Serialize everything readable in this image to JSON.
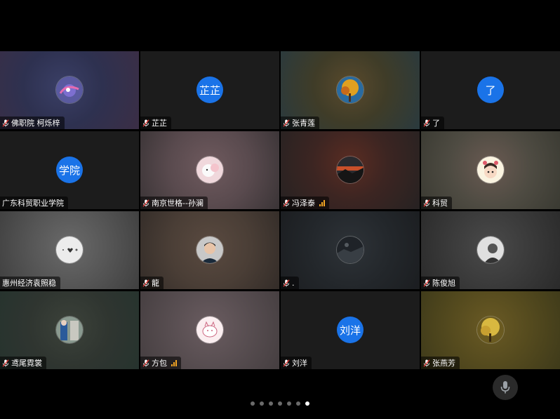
{
  "accent_color": "#1a73e8",
  "signal_color": "#f5a623",
  "icons": {
    "muted_mic": "mic-off-icon",
    "signal": "signal-bars-icon",
    "self_mic": "microphone-icon"
  },
  "participants": [
    {
      "name": "佛职院 柯烁梓",
      "muted": true,
      "avatar_kind": "image",
      "avatar_theme": "purple-wave",
      "tile_bg": "radial-gradient(circle at 45% 45%, #3a3f66 0%, #2e3150 45%, #3b2e45 100%)"
    },
    {
      "name": "芷芷",
      "muted": true,
      "avatar_kind": "text",
      "avatar_text": "芷芷",
      "tile_bg": "#1c1c1c"
    },
    {
      "name": "张青莲",
      "muted": true,
      "avatar_kind": "image",
      "avatar_theme": "autumn-tree",
      "tile_bg": "radial-gradient(circle at 50% 45%, #5a4a2c 0%, #3f3c28 45%, #2a3a3e 100%)"
    },
    {
      "name": "了",
      "muted": true,
      "avatar_kind": "text",
      "avatar_text": "了",
      "tile_bg": "#1c1c1c"
    },
    {
      "name": "广东科贸职业学院",
      "muted": false,
      "avatar_kind": "text",
      "avatar_text": "学院",
      "tile_bg": "#1c1c1c"
    },
    {
      "name": "南京世格--孙澜",
      "muted": true,
      "avatar_kind": "image",
      "avatar_theme": "pink-plush",
      "tile_bg": "radial-gradient(circle at 50% 45%, #6f5a5e 0%, #594a4e 50%, #3a3436 100%)"
    },
    {
      "name": "冯泽泰",
      "muted": true,
      "signal": true,
      "avatar_kind": "image",
      "avatar_theme": "sunset",
      "tile_bg": "radial-gradient(circle at 50% 40%, #5a2c22 0%, #3c2522 45%, #262222 100%)"
    },
    {
      "name": "科贸",
      "muted": true,
      "avatar_kind": "image",
      "avatar_theme": "bunny-girl",
      "tile_bg": "radial-gradient(circle at 50% 45%, #6a5a52 0%, #4e4b42 50%, #3a3a32 100%)"
    },
    {
      "name": "惠州经济袁照稳",
      "muted": false,
      "avatar_kind": "image",
      "avatar_theme": "white-heart",
      "tile_bg": "radial-gradient(circle at 50% 45%, #6a6a6a 0%, #555 50%, #3f3f3f 100%)"
    },
    {
      "name": "龍",
      "muted": true,
      "avatar_kind": "image",
      "avatar_theme": "portrait-man",
      "tile_bg": "radial-gradient(circle at 50% 45%, #5a4a40 0%, #4a3e36 50%, #332c28 100%)"
    },
    {
      "name": ".",
      "muted": true,
      "avatar_kind": "image",
      "avatar_theme": "dark-sky",
      "tile_bg": "radial-gradient(circle at 50% 45%, #2e3338 0%, #23272b 50%, #1b1d20 100%)"
    },
    {
      "name": "陈俊旭",
      "muted": true,
      "avatar_kind": "image",
      "avatar_theme": "bw-portrait",
      "tile_bg": "radial-gradient(circle at 50% 45%, #4a4a4a 0%, #3a3a3a 50%, #2a2a2a 100%)"
    },
    {
      "name": "鸢尾霓裳",
      "muted": true,
      "avatar_kind": "image",
      "avatar_theme": "street-blue",
      "tile_bg": "radial-gradient(circle at 50% 45%, #3c423a 0%, #2f3530 50%, #26332e 100%)"
    },
    {
      "name": "方包",
      "muted": true,
      "signal": true,
      "avatar_kind": "image",
      "avatar_theme": "pink-sketch",
      "tile_bg": "radial-gradient(circle at 50% 45%, #6a5c60 0%, #574d50 50%, #453e40 100%)"
    },
    {
      "name": "刘洋",
      "muted": true,
      "avatar_kind": "text",
      "avatar_text": "刘洋",
      "tile_bg": "#1c1c1c"
    },
    {
      "name": "张燕芳",
      "muted": true,
      "avatar_kind": "image",
      "avatar_theme": "golden-tree",
      "tile_bg": "radial-gradient(circle at 50% 45%, #6a5a24 0%, #544a1e 50%, #3e3a1a 100%)"
    }
  ],
  "pagination": {
    "count": 7,
    "active": 6
  }
}
